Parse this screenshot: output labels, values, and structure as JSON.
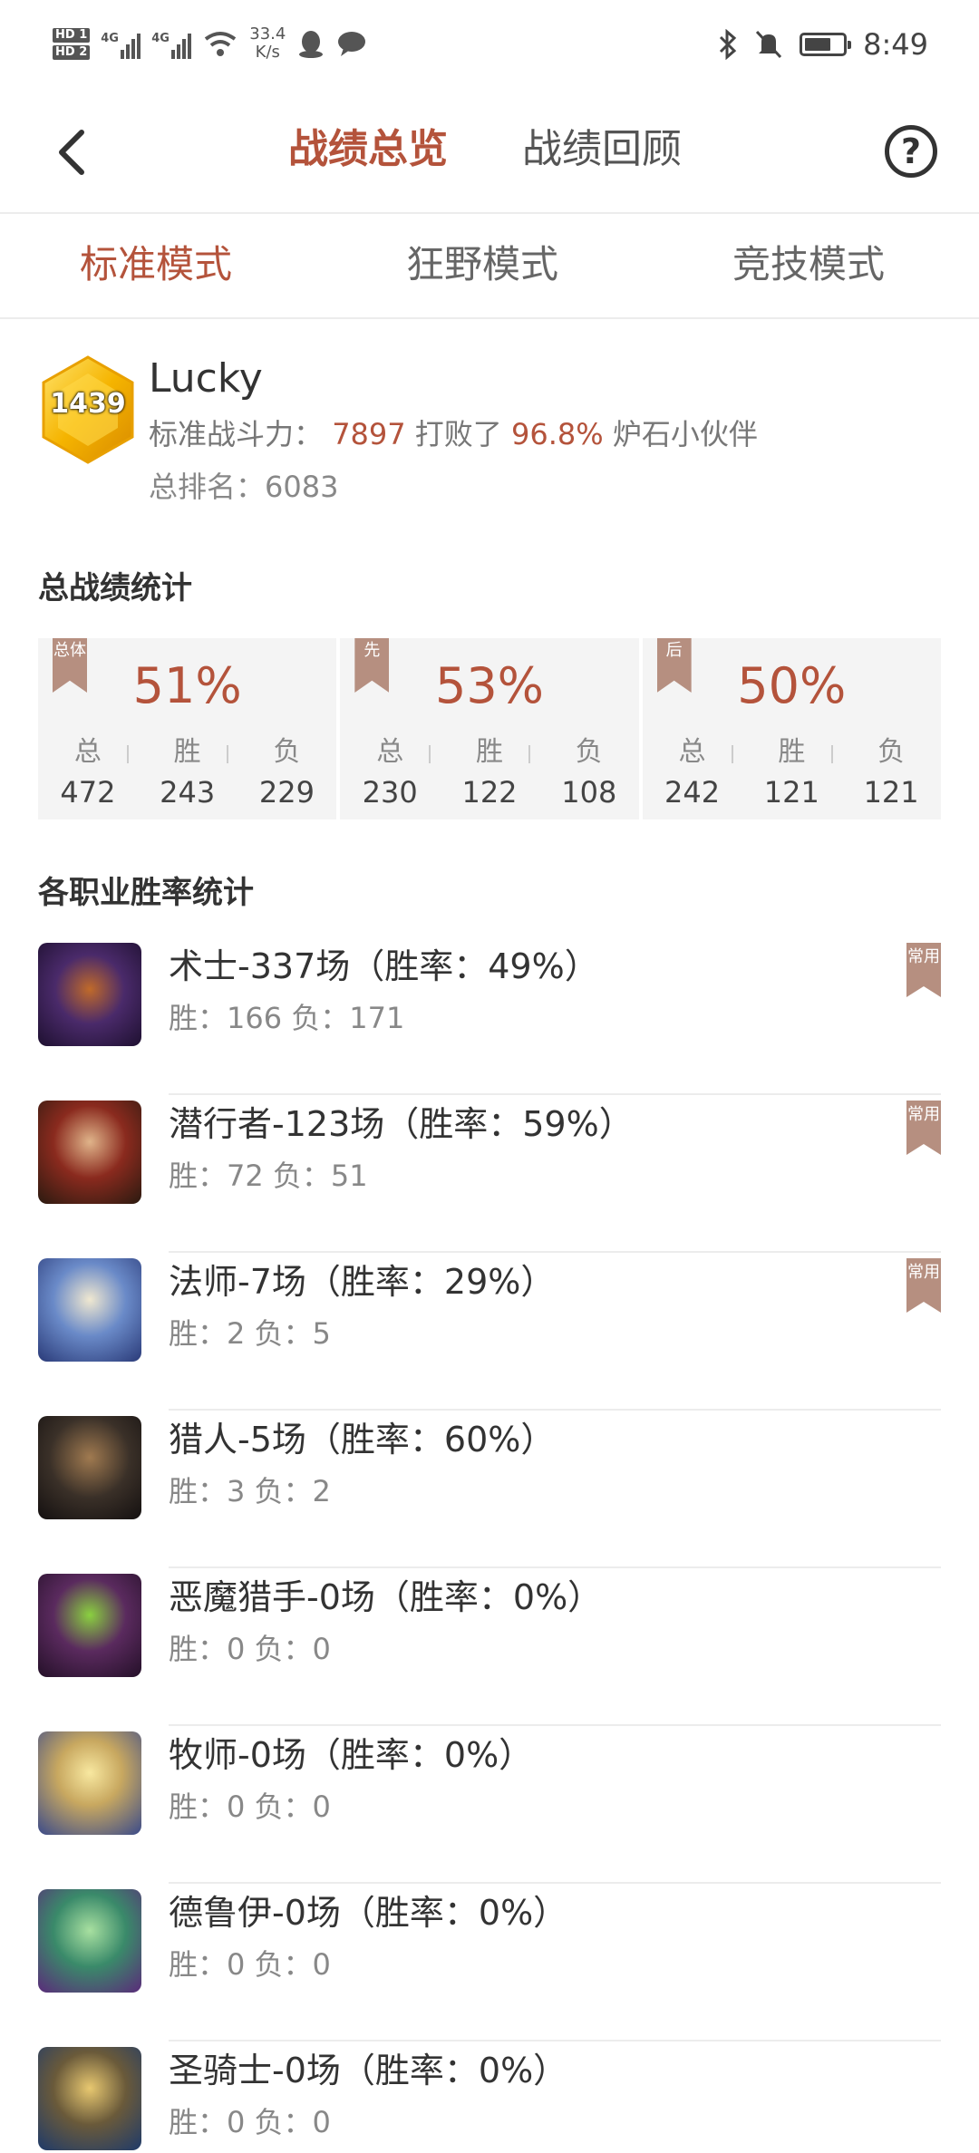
{
  "status_bar": {
    "hd1": "HD 1",
    "hd2": "HD 2",
    "net1": "4G",
    "net2": "4G",
    "wifi_tag": "6",
    "speed_value": "33.4",
    "speed_unit": "K/s",
    "time": "8:49",
    "battery_level": 0.7,
    "icons": [
      "qq-icon",
      "message-icon",
      "bluetooth-icon",
      "mute-icon",
      "battery-icon"
    ]
  },
  "header": {
    "tab_active": "战绩总览",
    "tab_inactive": "战绩回顾",
    "help_glyph": "?"
  },
  "modes": {
    "standard": "标准模式",
    "wild": "狂野模式",
    "arena": "竞技模式"
  },
  "profile": {
    "rank": "1439",
    "name": "Lucky",
    "power_label": "标准战斗力：",
    "power_value": "7897",
    "beat_label": "打败了",
    "beat_value": "96.8%",
    "beat_suffix": "炉石小伙伴",
    "total_rank_label": "总排名：",
    "total_rank_value": "6083"
  },
  "overall": {
    "title": "总战绩统计",
    "cards": [
      {
        "flag": "总体",
        "pct": "51%",
        "labels": [
          "总",
          "胜",
          "负"
        ],
        "values": [
          "472",
          "243",
          "229"
        ]
      },
      {
        "flag": "先",
        "pct": "53%",
        "labels": [
          "总",
          "胜",
          "负"
        ],
        "values": [
          "230",
          "122",
          "108"
        ]
      },
      {
        "flag": "后",
        "pct": "50%",
        "labels": [
          "总",
          "胜",
          "负"
        ],
        "values": [
          "242",
          "121",
          "121"
        ]
      }
    ]
  },
  "classes": {
    "title": "各职业胜率统计",
    "items": [
      {
        "title": "术士-337场（胜率：49%）",
        "detail": "胜：166 负：171",
        "flag": "常用",
        "avatar_color": "#4a2a6a"
      },
      {
        "title": "潜行者-123场（胜率：59%）",
        "detail": "胜：72 负：51",
        "flag": "常用",
        "avatar_color": "#7a2a1e"
      },
      {
        "title": "法师-7场（胜率：29%）",
        "detail": "胜：2 负：5",
        "flag": "常用",
        "avatar_color": "#4a6aa8"
      },
      {
        "title": "猎人-5场（胜率：60%）",
        "detail": "胜：3 负：2",
        "flag": "",
        "avatar_color": "#3a3028"
      },
      {
        "title": "恶魔猎手-0场（胜率：0%）",
        "detail": "胜：0 负：0",
        "flag": "",
        "avatar_color": "#4a2a4e"
      },
      {
        "title": "牧师-0场（胜率：0%）",
        "detail": "胜：0 负：0",
        "flag": "",
        "avatar_color": "#c8a860"
      },
      {
        "title": "德鲁伊-0场（胜率：0%）",
        "detail": "胜：0 负：0",
        "flag": "",
        "avatar_color": "#3a8a6a"
      },
      {
        "title": "圣骑士-0场（胜率：0%）",
        "detail": "胜：0 负：0",
        "flag": "",
        "avatar_color": "#6a5a3a"
      }
    ]
  },
  "colors": {
    "accent": "#b4533b",
    "flag": "#b68f80",
    "card_bg": "#f4f4f4"
  }
}
